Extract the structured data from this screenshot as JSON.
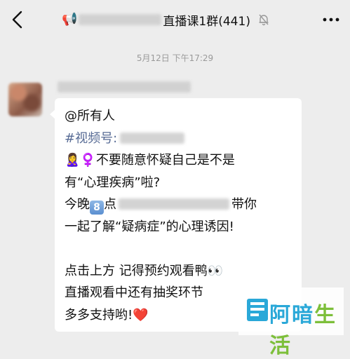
{
  "header": {
    "emoji": "📢",
    "title_visible": "直播课1群(441)"
  },
  "timestamp": "5月12日 下午17:29",
  "message": {
    "lines": [
      "@所有人",
      "#视频号:",
      "🙎‍♀️♀️不要随意怀疑自己是不是",
      "有“心理疾病”啦?",
      "今晚",
      "点",
      "带你",
      "一起了解“疑病症”的心理诱因!",
      "",
      "点击上方 记得预约观看鸭👀",
      "直播观看中还有抽奖环节",
      "多多支持哟!",
      "❤️"
    ],
    "key_emoji": "8"
  },
  "watermark": {
    "text_a": "阿",
    "text_b": "暗",
    "text_c": "生活"
  },
  "colors": {
    "background": "#ededed",
    "bubble": "#ffffff",
    "hashtag": "#576b95",
    "timestamp": "#9a9a9a"
  },
  "icons": [
    "chevron-left-icon",
    "megaphone-icon",
    "mute-bell-icon",
    "more-icon",
    "avatar",
    "heart-icon",
    "eyes-icon"
  ]
}
